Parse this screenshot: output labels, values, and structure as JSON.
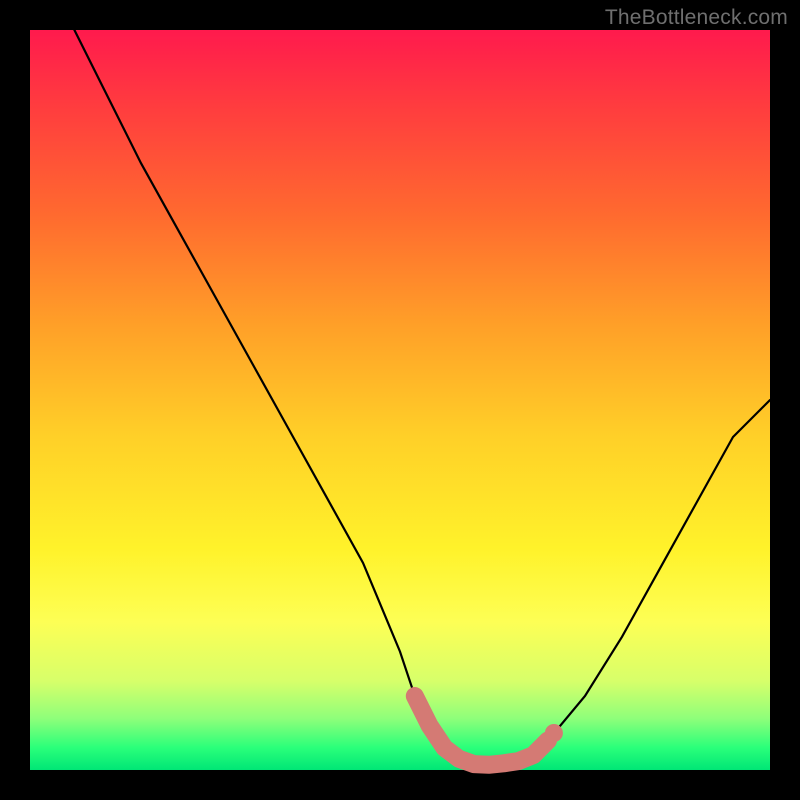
{
  "watermark": "TheBottleneck.com",
  "chart_data": {
    "type": "line",
    "title": "",
    "xlabel": "",
    "ylabel": "",
    "xlim": [
      0,
      100
    ],
    "ylim": [
      0,
      100
    ],
    "series": [
      {
        "name": "bottleneck-curve",
        "x": [
          6,
          10,
          15,
          20,
          25,
          30,
          35,
          40,
          45,
          50,
          52,
          55,
          58,
          60,
          62,
          64,
          66,
          68,
          70,
          75,
          80,
          85,
          90,
          95,
          100
        ],
        "values": [
          100,
          92,
          82,
          73,
          64,
          55,
          46,
          37,
          28,
          16,
          10,
          4,
          1,
          0,
          0,
          0,
          0.5,
          1.5,
          4,
          10,
          18,
          27,
          36,
          45,
          50
        ]
      },
      {
        "name": "highlight-band",
        "x": [
          52,
          54,
          56,
          58,
          60,
          62,
          64,
          66,
          68,
          70
        ],
        "values": [
          10,
          6,
          3,
          1.5,
          0.8,
          0.7,
          0.9,
          1.2,
          2,
          4
        ]
      }
    ],
    "colors": {
      "curve": "#000000",
      "highlight": "#d47a74"
    }
  }
}
